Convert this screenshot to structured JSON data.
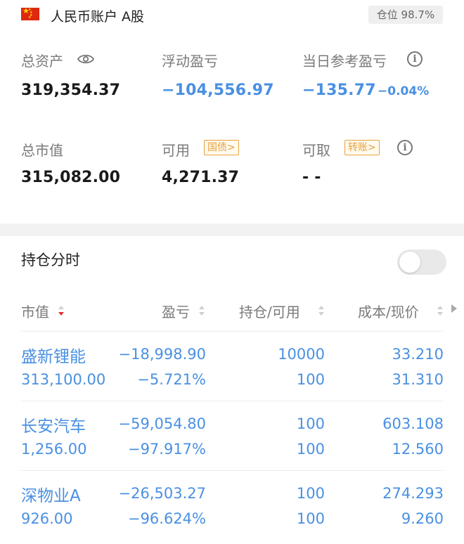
{
  "header": {
    "account_label": "人民币账户 A股",
    "position_badge": "仓位 98.7%"
  },
  "summary": {
    "total_assets_label": "总资产",
    "total_assets_value": "319,354.37",
    "floating_pl_label": "浮动盈亏",
    "floating_pl_value": "−104,556.97",
    "daily_pl_label": "当日参考盈亏",
    "daily_pl_value": "−135.77",
    "daily_pl_pct": "−0.04%",
    "market_value_label": "总市值",
    "market_value_value": "315,082.00",
    "available_label": "可用",
    "available_tag": "国债>",
    "available_value": "4,271.37",
    "withdrawable_label": "可取",
    "withdrawable_tag": "转账>",
    "withdrawable_value": "- -"
  },
  "holdings": {
    "title": "持仓分时",
    "toggle_on": false,
    "columns": [
      "市值",
      "盈亏",
      "持仓/可用",
      "成本/现价"
    ],
    "rows": [
      {
        "name": "盛新锂能",
        "market_value": "313,100.00",
        "pl": "−18,998.90",
        "pl_pct": "−5.721%",
        "position": "10000",
        "available": "100",
        "cost": "33.210",
        "price": "31.310"
      },
      {
        "name": "长安汽车",
        "market_value": "1,256.00",
        "pl": "−59,054.80",
        "pl_pct": "−97.917%",
        "position": "100",
        "available": "100",
        "cost": "603.108",
        "price": "12.560"
      },
      {
        "name": "深物业A",
        "market_value": "926.00",
        "pl": "−26,503.27",
        "pl_pct": "−96.624%",
        "position": "100",
        "available": "100",
        "cost": "274.293",
        "price": "9.260"
      }
    ]
  },
  "colors": {
    "loss_blue": "#4a90e2",
    "tag_orange": "#e6a23c",
    "sort_active_red": "#e03030"
  }
}
